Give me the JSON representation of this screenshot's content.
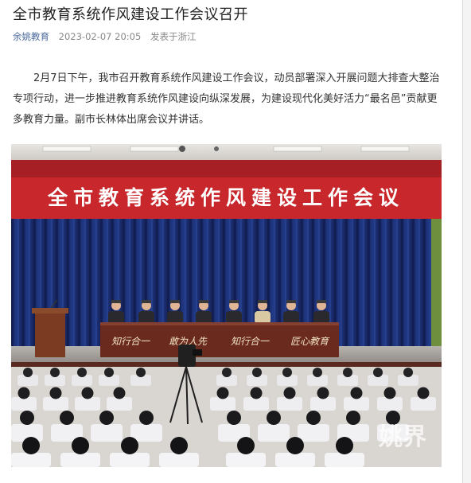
{
  "article": {
    "title": "全市教育系统作风建设工作会议召开",
    "meta": {
      "author": "余姚教育",
      "datetime": "2023-02-07 20:05",
      "location": "发表于浙江"
    },
    "body": "2月7日下午，我市召开教育系统作风建设工作会议，动员部署深入开展问题大排查大整治专项行动，进一步推进教育系统作风建设向纵深发展，为建设现代化美好活力“最名邑”贡献更多教育力量。副市长林体出席会议并讲话。"
  },
  "photo": {
    "banner_text": "全市教育系统作风建设工作会议",
    "table_slogans": [
      "知行合一",
      "敢为人先",
      "知行合一",
      "匠心教育"
    ],
    "watermark": "姚界"
  },
  "colors": {
    "banner_red": "#c8282c",
    "curtain_blue": "#1c2f74",
    "stage_table": "#6b2a1e",
    "meta_author": "#4a6a9c"
  }
}
